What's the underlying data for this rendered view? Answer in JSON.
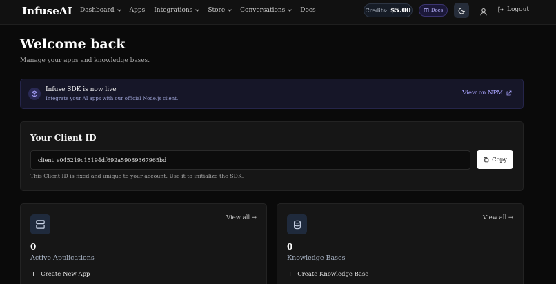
{
  "nav": {
    "brand": "InfuseAI",
    "links": [
      {
        "label": "Dashboard",
        "dropdown": true
      },
      {
        "label": "Apps",
        "dropdown": false
      },
      {
        "label": "Integrations",
        "dropdown": true
      },
      {
        "label": "Store",
        "dropdown": true
      },
      {
        "label": "Conversations",
        "dropdown": true
      },
      {
        "label": "Docs",
        "dropdown": false
      }
    ],
    "credits_label": "Credits:",
    "credits_value": "$5.00",
    "docs_label": "Docs",
    "logout_label": "Logout"
  },
  "header": {
    "title": "Welcome back",
    "subtitle": "Manage your apps and knowledge bases."
  },
  "banner": {
    "title": "Infuse SDK is now live",
    "subtitle": "Integrate your AI apps with our official Node.js client.",
    "link_label": "View on NPM"
  },
  "client_id": {
    "title": "Your Client ID",
    "value": "client_e045219c15194df692a59089367965bd",
    "copy_label": "Copy",
    "note": "This Client ID is fixed and unique to your account. Use it to initialize the SDK."
  },
  "apps_card": {
    "view_all": "View all →",
    "count": "0",
    "label": "Active Applications",
    "action": "Create New App"
  },
  "kb_card": {
    "view_all": "View all →",
    "count": "0",
    "label": "Knowledge Bases",
    "action": "Create Knowledge Base"
  },
  "colors": {
    "background": "#0a0a0a",
    "card": "#161616",
    "banner": "#161628",
    "accent": "#a9a4ff"
  }
}
